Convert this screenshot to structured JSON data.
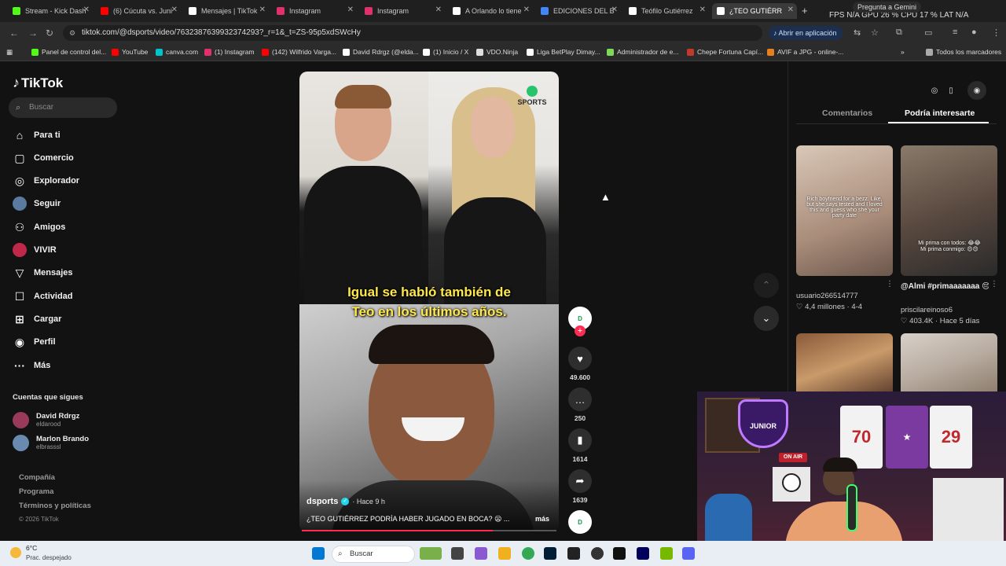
{
  "browser": {
    "tabs": [
      {
        "label": "Stream - Kick Dash",
        "fav_color": "#53fc18"
      },
      {
        "label": "(6) Cúcuta vs. Juni",
        "fav_color": "#ff0000"
      },
      {
        "label": "Mensajes | TikTok",
        "fav_color": "#ffffff"
      },
      {
        "label": "Instagram",
        "fav_color": "#e1306c"
      },
      {
        "label": "Instagram",
        "fav_color": "#e1306c"
      },
      {
        "label": "A Orlando lo tiene",
        "fav_color": "#ffffff"
      },
      {
        "label": "EDICIONES DEL B",
        "fav_color": "#4285f4"
      },
      {
        "label": "Teófilo Gutiérrez",
        "fav_color": "#ffffff"
      },
      {
        "label": "¿TEO GUTIÉRR",
        "fav_color": "#ffffff"
      }
    ],
    "new_tab": "+",
    "gemini_label": "Pregunta a Gemini",
    "stats": "FPS N/A   GPU 26 %   CPU 17 %   LAT N/A",
    "url": "tiktok.com/@dsports/video/7632387639932374293?_r=1&_t=ZS-95p5xdSWcHy",
    "open_app": "Abrir en aplicación",
    "bookmarks": [
      {
        "label": "Panel de control del...",
        "fav_color": "#53fc18"
      },
      {
        "label": "YouTube",
        "fav_color": "#ff0000"
      },
      {
        "label": "canva.com",
        "fav_color": "#00c4cc"
      },
      {
        "label": "(1) Instagram",
        "fav_color": "#e1306c"
      },
      {
        "label": "(142) Wilfrido Varga...",
        "fav_color": "#ff0000"
      },
      {
        "label": "David Rdrgz (@elda...",
        "fav_color": "#ffffff"
      },
      {
        "label": "(1) Inicio / X",
        "fav_color": "#ffffff"
      },
      {
        "label": "VDO.Ninja",
        "fav_color": "#dddddd"
      },
      {
        "label": "Liga BetPlay Dimay...",
        "fav_color": "#ffffff"
      },
      {
        "label": "Administrador de e...",
        "fav_color": "#7ed957"
      },
      {
        "label": "Chepe Fortuna Capí...",
        "fav_color": "#c0392b"
      },
      {
        "label": "AVIF a JPG - online-...",
        "fav_color": "#e67e22"
      }
    ],
    "all_bookmarks": "Todos los marcadores"
  },
  "tiktok": {
    "logo": "TikTok",
    "search_placeholder": "Buscar",
    "nav": [
      {
        "label": "Para ti",
        "icon": "home-icon",
        "glyph": "⌂"
      },
      {
        "label": "Comercio",
        "icon": "shop-icon",
        "glyph": "▢"
      },
      {
        "label": "Explorador",
        "icon": "compass-icon",
        "glyph": "◎"
      },
      {
        "label": "Seguir",
        "icon": "following-avatar",
        "glyph": ""
      },
      {
        "label": "Amigos",
        "icon": "friends-icon",
        "glyph": "⚇"
      },
      {
        "label": "VIVIR",
        "icon": "live-avatar",
        "glyph": ""
      },
      {
        "label": "Mensajes",
        "icon": "send-icon",
        "glyph": "▽"
      },
      {
        "label": "Actividad",
        "icon": "inbox-icon",
        "glyph": "☐"
      },
      {
        "label": "Cargar",
        "icon": "upload-icon",
        "glyph": "⊞"
      },
      {
        "label": "Perfil",
        "icon": "profile-icon",
        "glyph": "◉"
      },
      {
        "label": "Más",
        "icon": "more-icon",
        "glyph": "···"
      }
    ],
    "following_title": "Cuentas que sigues",
    "following": [
      {
        "name": "David Rdrgz",
        "handle": "eldarood"
      },
      {
        "name": "Marlon Brando",
        "handle": "elbrasssl"
      }
    ],
    "footer": [
      "Compañía",
      "Programa",
      "Términos y políticas"
    ],
    "copyright": "© 2026 TikTok"
  },
  "video": {
    "overlay_line1": "Igual se habló también de",
    "overlay_line2": "Teo en los últimos años.",
    "logo_text": "SPORTS",
    "author": "dsports",
    "time": "· Hace 9 h",
    "description": "¿TEO GUTIÉRREZ PODRÍA HABER JUGADO EN BOCA? 😦 ...",
    "more": "más",
    "progress": 0.75,
    "likes": "49.600",
    "comments": "250",
    "saves": "1614",
    "shares": "1639",
    "creator_badge": "D"
  },
  "right_panel": {
    "tab_comments": "Comentarios",
    "tab_recommend": "Podría interesarte",
    "items": [
      {
        "title": "",
        "user": "usuario266514777",
        "views": "4,4 millones",
        "date": "4-4",
        "thumb_text": "Rich boyfriend for a bezz. Like, but she says tested and I loved this and guess who she your party date"
      },
      {
        "title": "@Almi #primaaaaaaa 😔",
        "user": "priscilareinoso6",
        "views": "403.4K",
        "date": "Hace 5 días",
        "thumb_text": "Mi prima con todos: 😂😂\nMi prima conmigo: 😍😍"
      }
    ]
  },
  "webcam": {
    "on_air": "ON AIR",
    "badge": "JUNIOR",
    "jersey1": "70",
    "jersey2": "29"
  },
  "taskbar": {
    "temp": "6°C",
    "weather": "Prac. despejado",
    "search": "Buscar"
  }
}
